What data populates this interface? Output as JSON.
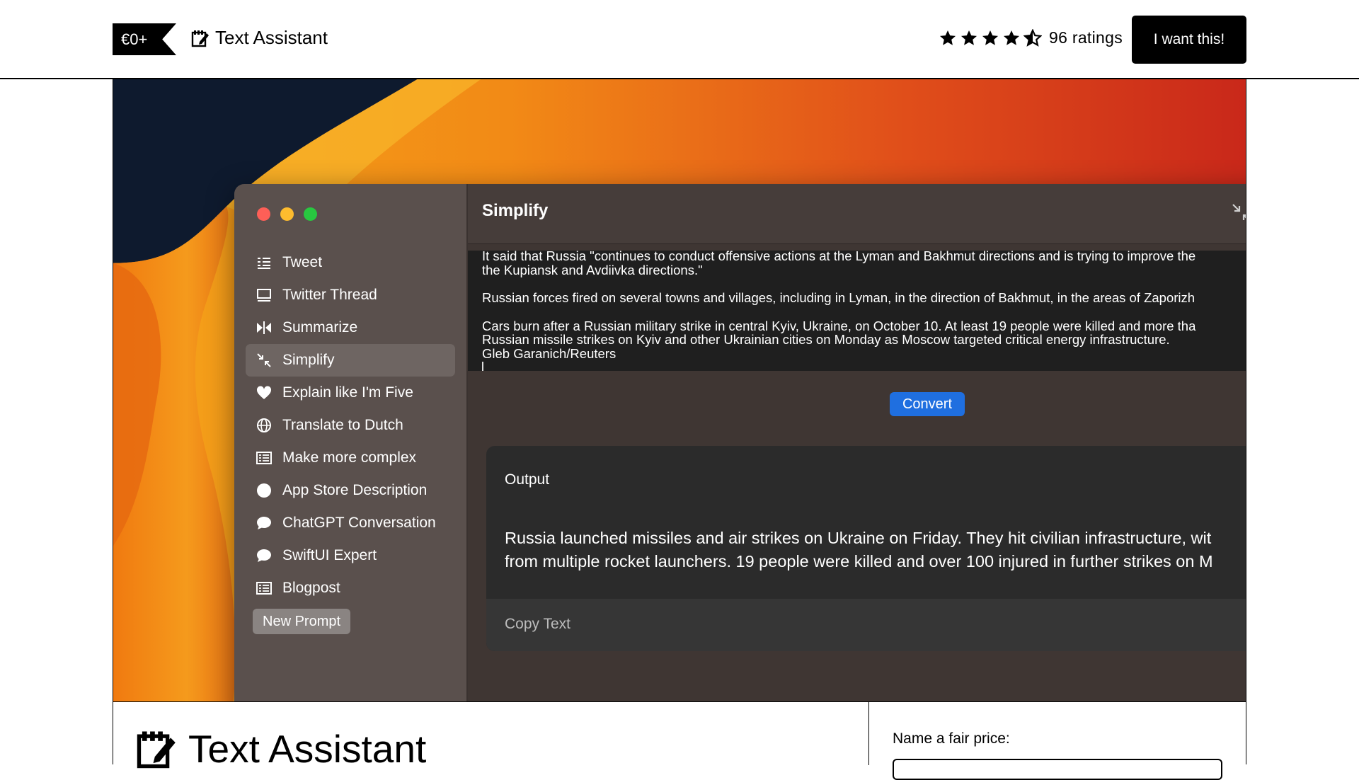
{
  "header": {
    "price_tag": "€0+",
    "product_name": "Text Assistant",
    "rating_count": "96 ratings",
    "rating_value": 4.5,
    "buy_button": "I want this!"
  },
  "app_window": {
    "title": "Simplify",
    "sidebar_items": [
      {
        "label": "Tweet",
        "icon": "tweet-lines-icon"
      },
      {
        "label": "Twitter Thread",
        "icon": "thread-icon"
      },
      {
        "label": "Summarize",
        "icon": "summarize-icon"
      },
      {
        "label": "Simplify",
        "icon": "simplify-arrows-icon",
        "active": true
      },
      {
        "label": "Explain like I'm Five",
        "icon": "heart-icon"
      },
      {
        "label": "Translate to Dutch",
        "icon": "globe-icon"
      },
      {
        "label": "Make more complex",
        "icon": "list-icon"
      },
      {
        "label": "App Store Description",
        "icon": "circle-icon"
      },
      {
        "label": "ChatGPT Conversation",
        "icon": "chat-bubble-icon"
      },
      {
        "label": "SwiftUI Expert",
        "icon": "chat-bubble-icon"
      },
      {
        "label": "Blogpost",
        "icon": "list-icon"
      }
    ],
    "new_prompt_button": "New Prompt",
    "input_lines": [
      "It said that Russia \"continues to conduct offensive actions at the Lyman and Bakhmut directions and is trying to improve the",
      "the Kupiansk and Avdiivka directions.\"",
      "",
      "Russian forces fired on several towns and villages, including in Lyman, in the direction of Bakhmut, in the areas of Zaporizh",
      "",
      "Cars burn after a Russian military strike in central Kyiv, Ukraine, on October 10. At least 19 people were killed and more tha",
      "Russian missile strikes on Kyiv and other Ukrainian cities on Monday as Moscow targeted critical energy infrastructure.",
      "Gleb Garanich/Reuters"
    ],
    "convert_button": "Convert",
    "output_label": "Output",
    "output_lines": [
      "Russia launched missiles and air strikes on Ukraine on Friday. They hit civilian infrastructure, wit",
      "from multiple rocket launchers. 19 people were killed and over 100 injured in further strikes on M"
    ],
    "copy_button": "Copy Text"
  },
  "bottom": {
    "product_title": "Text Assistant",
    "fair_price_label": "Name a fair price:"
  },
  "colors": {
    "accent_blue": "#1f6fe0",
    "traffic_red": "#fe5f57",
    "traffic_yellow": "#febc2e",
    "traffic_green": "#28c840"
  }
}
